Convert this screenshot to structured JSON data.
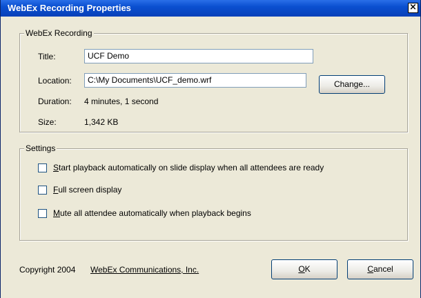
{
  "window": {
    "title": "WebEx Recording Properties",
    "close_glyph": "×"
  },
  "recording": {
    "group_title": "WebEx Recording",
    "title_label": "Title:",
    "title_value": "UCF Demo",
    "location_label": "Location:",
    "location_value": "C:\\My Documents\\UCF_demo.wrf",
    "change_button": "Change...",
    "duration_label": "Duration:",
    "duration_value": "4 minutes, 1 second",
    "size_label": "Size:",
    "size_value": "1,342 KB"
  },
  "settings": {
    "group_title": "Settings",
    "options": [
      {
        "mnemonic": "S",
        "rest": "tart playback automatically on slide display when all attendees are ready",
        "checked": false
      },
      {
        "mnemonic": "F",
        "rest": "ull screen display",
        "checked": false
      },
      {
        "mnemonic": "M",
        "rest": "ute all attendee automatically when playback begins",
        "checked": false
      }
    ]
  },
  "footer": {
    "copyright": "Copyright 2004",
    "company_link": "WebEx Communications, Inc.",
    "ok_mnemonic": "O",
    "ok_rest": "K",
    "cancel_mnemonic": "C",
    "cancel_rest": "ancel"
  }
}
